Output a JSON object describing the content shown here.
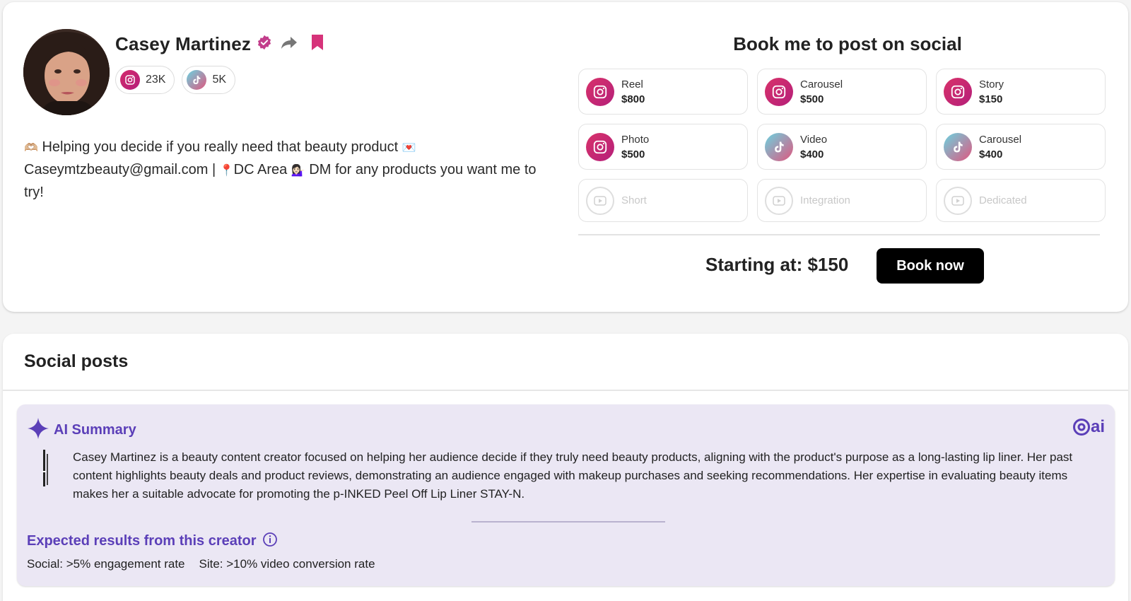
{
  "profile": {
    "name": "Casey Martinez",
    "instagram_followers": "23K",
    "tiktok_followers": "5K",
    "bio_line1": "Helping you decide if you really need that beauty product",
    "bio_line2": "Caseymtzbeauty@gmail.com |",
    "bio_area": "DC Area",
    "bio_line3": "DM for any products you want me to try!",
    "icons": [
      "verified-badge-icon",
      "share-icon",
      "bookmark-icon",
      "instagram-icon",
      "tiktok-icon"
    ]
  },
  "booking": {
    "title": "Book me to post on social",
    "tiles": [
      {
        "label": "Reel",
        "price": "$800",
        "platform": "instagram"
      },
      {
        "label": "Carousel",
        "price": "$500",
        "platform": "instagram"
      },
      {
        "label": "Story",
        "price": "$150",
        "platform": "instagram"
      },
      {
        "label": "Photo",
        "price": "$500",
        "platform": "instagram"
      },
      {
        "label": "Video",
        "price": "$400",
        "platform": "tiktok"
      },
      {
        "label": "Carousel",
        "price": "$400",
        "platform": "tiktok"
      },
      {
        "label": "Short",
        "platform": "youtube",
        "disabled": true
      },
      {
        "label": "Integration",
        "platform": "youtube",
        "disabled": true
      },
      {
        "label": "Dedicated",
        "platform": "youtube",
        "disabled": true
      }
    ],
    "starting_label": "Starting at: $150",
    "book_button": "Book now"
  },
  "posts": {
    "title": "Social posts",
    "ai_summary": {
      "title": "AI Summary",
      "logo_text": "ai",
      "text": "Casey Martinez is a beauty content creator focused on helping her audience decide if they truly need beauty products, aligning with the product's purpose as a long-lasting lip liner. Her past content highlights beauty deals and product reviews, demonstrating an audience engaged with makeup purchases and seeking recommendations. Her expertise in evaluating beauty items makes her a suitable advocate for promoting the p-INKED Peel Off Lip Liner STAY-N.",
      "expected_title": "Expected results from this creator",
      "metric_social": "Social: >5% engagement rate",
      "metric_site": "Site: >10% video conversion rate"
    }
  },
  "colors": {
    "accent_purple": "#5b3fb8",
    "brand_pink": "#d6337a",
    "button_black": "#000000",
    "ai_background": "#ebe7f4"
  }
}
